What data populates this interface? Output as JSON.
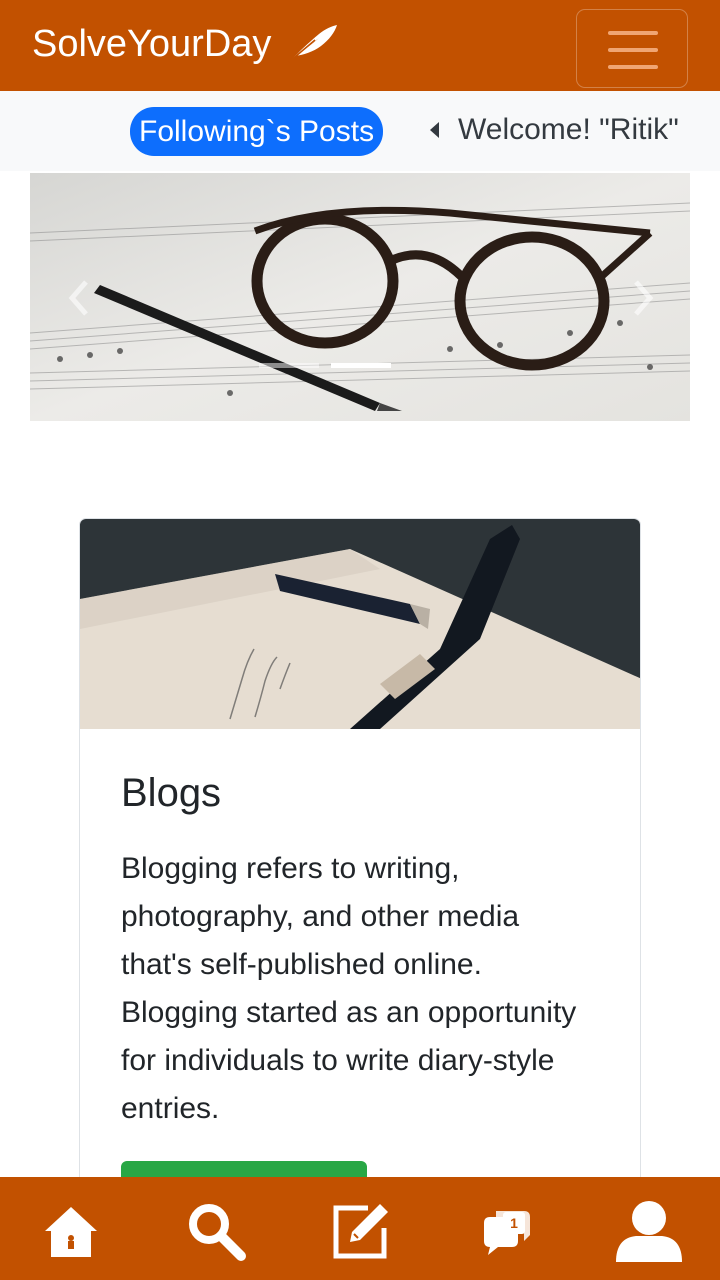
{
  "navbar": {
    "brand": "SolveYourDay",
    "brand_icon": "feather-icon",
    "menu_icon": "hamburger-icon",
    "background": "#c25100"
  },
  "subbar": {
    "following_label": "Following`s Posts",
    "welcome_text": "Welcome! \"Ritik\"",
    "pill_color": "#0d6efd"
  },
  "carousel": {
    "slide_image": "glasses-pen-sheet-music",
    "prev_icon": "chevron-left-icon",
    "next_icon": "chevron-right-icon",
    "indicator_count": 2,
    "active_indicator": 2
  },
  "card": {
    "image": "fountain-pen-notebook",
    "title": "Blogs",
    "text": "Blogging refers to writing, photography, and other media that's self-published online. Blogging started as an opportunity for individuals to write diary-style entries.",
    "button_color": "#28a745"
  },
  "bottom_nav": {
    "items": [
      "home-icon",
      "search-icon",
      "edit-icon",
      "chat-icon",
      "user-icon"
    ],
    "notification_count": "1"
  }
}
